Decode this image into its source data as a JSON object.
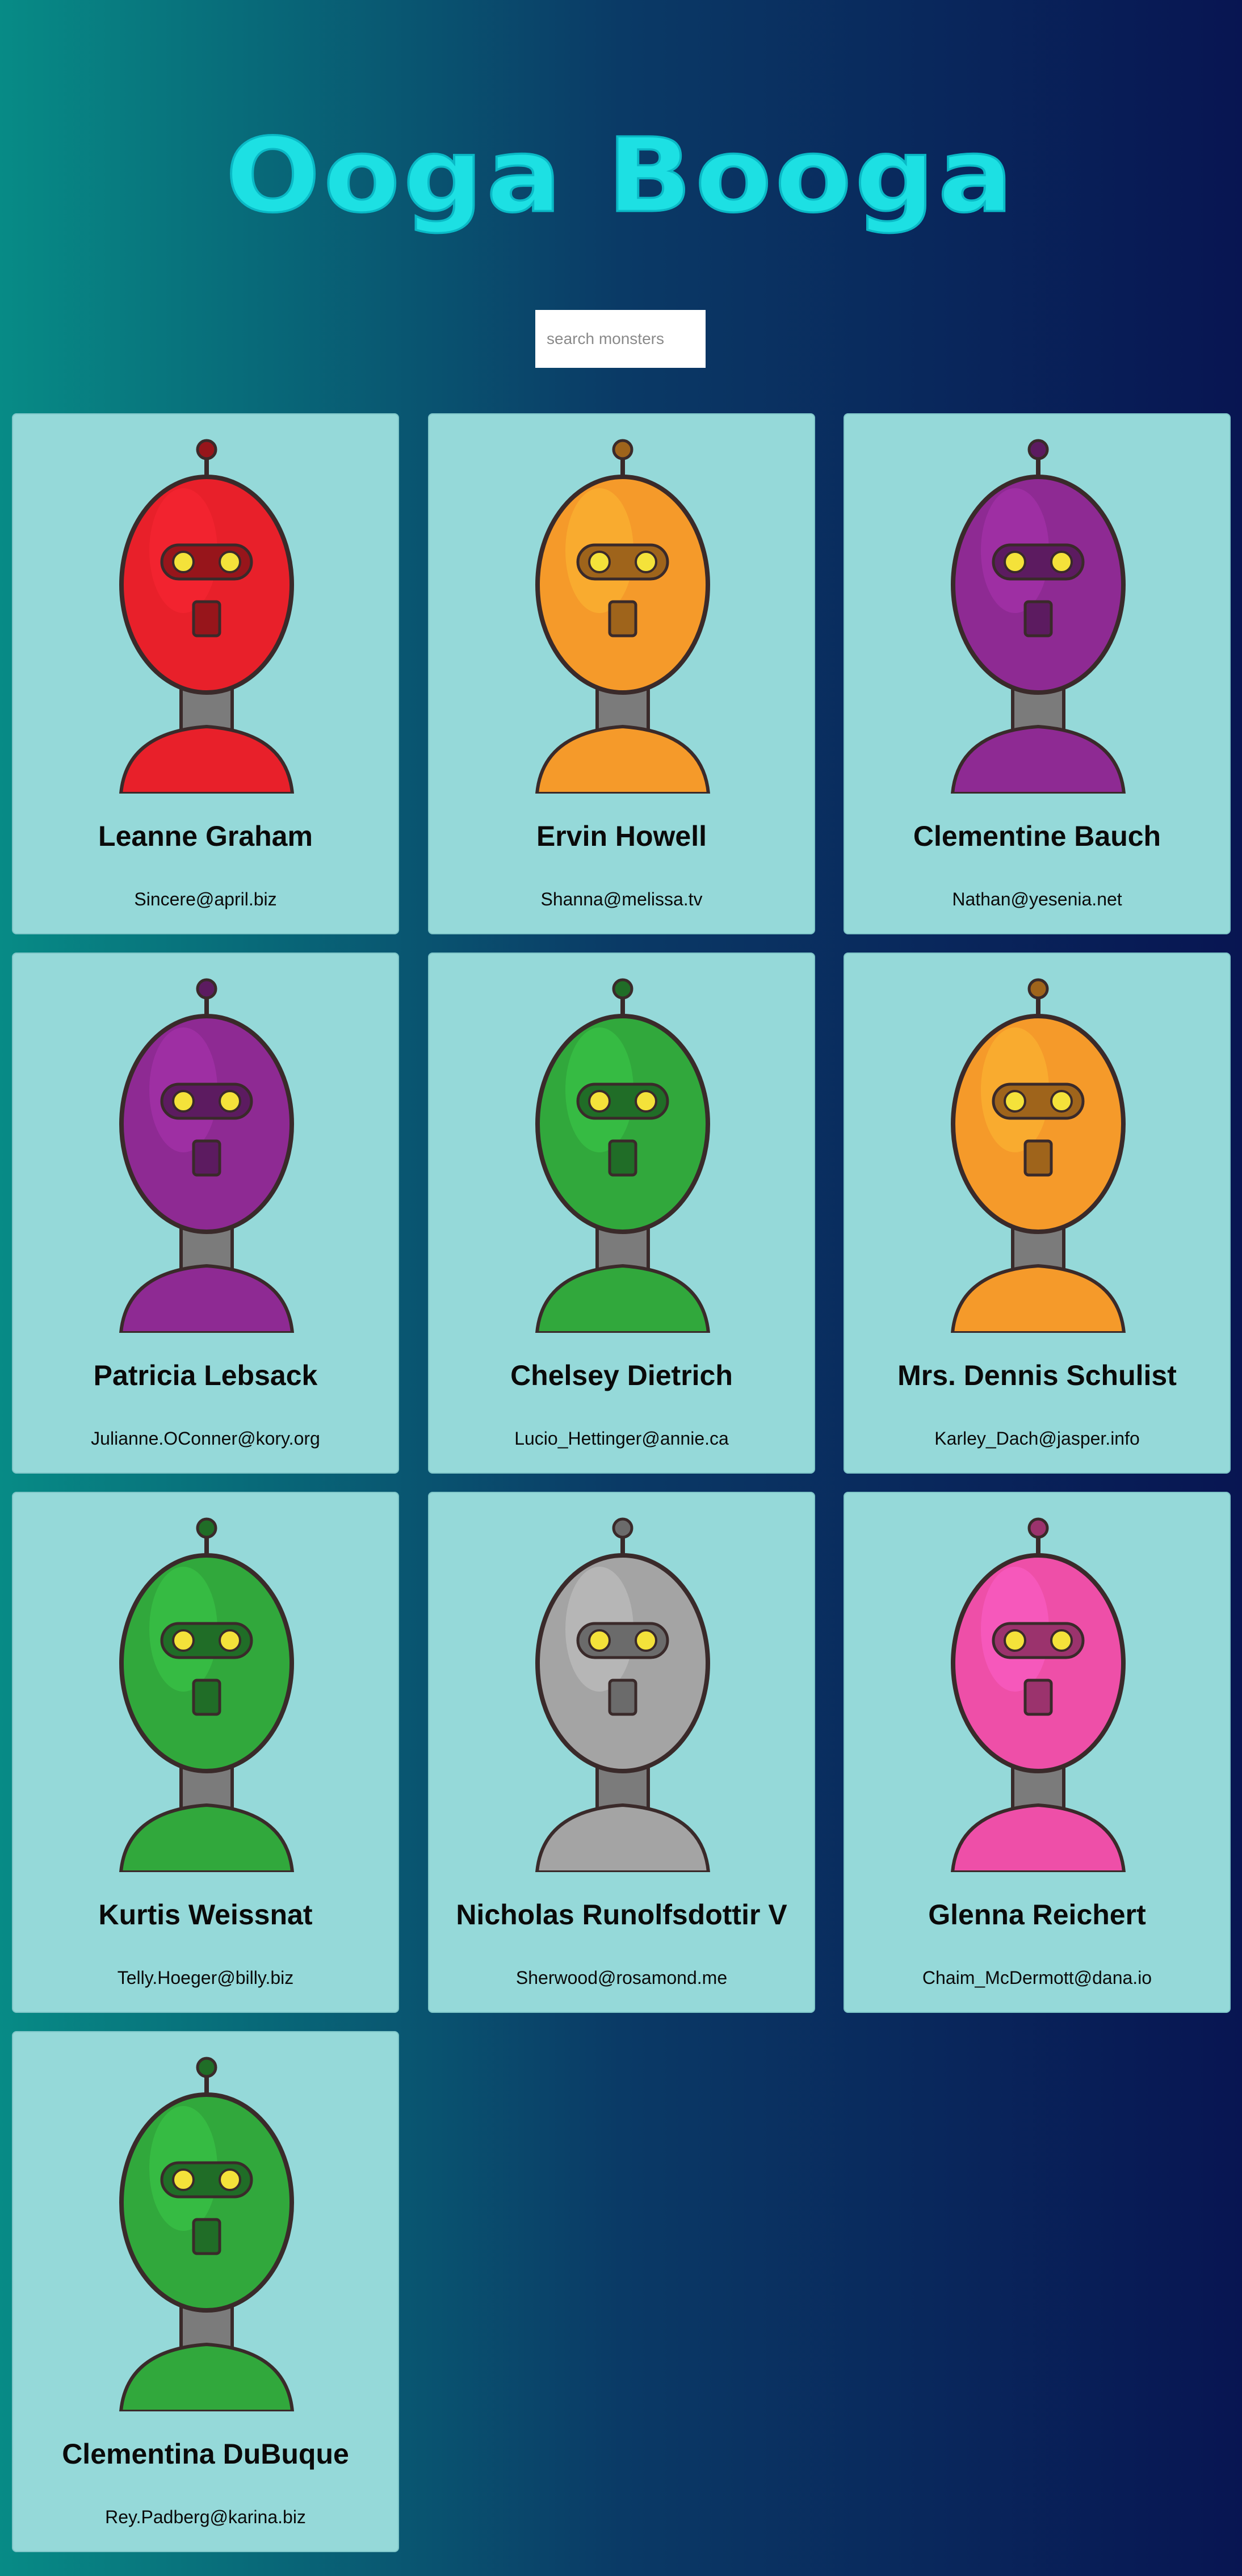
{
  "app": {
    "title": "Ooga Booga",
    "search_placeholder": "search monsters",
    "search_value": ""
  },
  "monsters": [
    {
      "name": "Leanne Graham",
      "email": "Sincere@april.biz",
      "color": "#e8202a",
      "icon": "robot-avatar"
    },
    {
      "name": "Ervin Howell",
      "email": "Shanna@melissa.tv",
      "color": "#f59a2a",
      "icon": "robot-avatar"
    },
    {
      "name": "Clementine Bauch",
      "email": "Nathan@yesenia.net",
      "color": "#8e2a93",
      "icon": "robot-avatar"
    },
    {
      "name": "Patricia Lebsack",
      "email": "Julianne.OConner@kory.org",
      "color": "#8e2a93",
      "icon": "robot-avatar"
    },
    {
      "name": "Chelsey Dietrich",
      "email": "Lucio_Hettinger@annie.ca",
      "color": "#31a83c",
      "icon": "robot-avatar"
    },
    {
      "name": "Mrs. Dennis Schulist",
      "email": "Karley_Dach@jasper.info",
      "color": "#f59a2a",
      "icon": "robot-avatar"
    },
    {
      "name": "Kurtis Weissnat",
      "email": "Telly.Hoeger@billy.biz",
      "color": "#31a83c",
      "icon": "robot-avatar"
    },
    {
      "name": "Nicholas Runolfsdottir V",
      "email": "Sherwood@rosamond.me",
      "color": "#a4a4a4",
      "icon": "robot-avatar"
    },
    {
      "name": "Glenna Reichert",
      "email": "Chaim_McDermott@dana.io",
      "color": "#ee4fa8",
      "icon": "robot-avatar"
    },
    {
      "name": "Clementina DuBuque",
      "email": "Rey.Padberg@karina.biz",
      "color": "#31a83c",
      "icon": "robot-avatar"
    }
  ]
}
